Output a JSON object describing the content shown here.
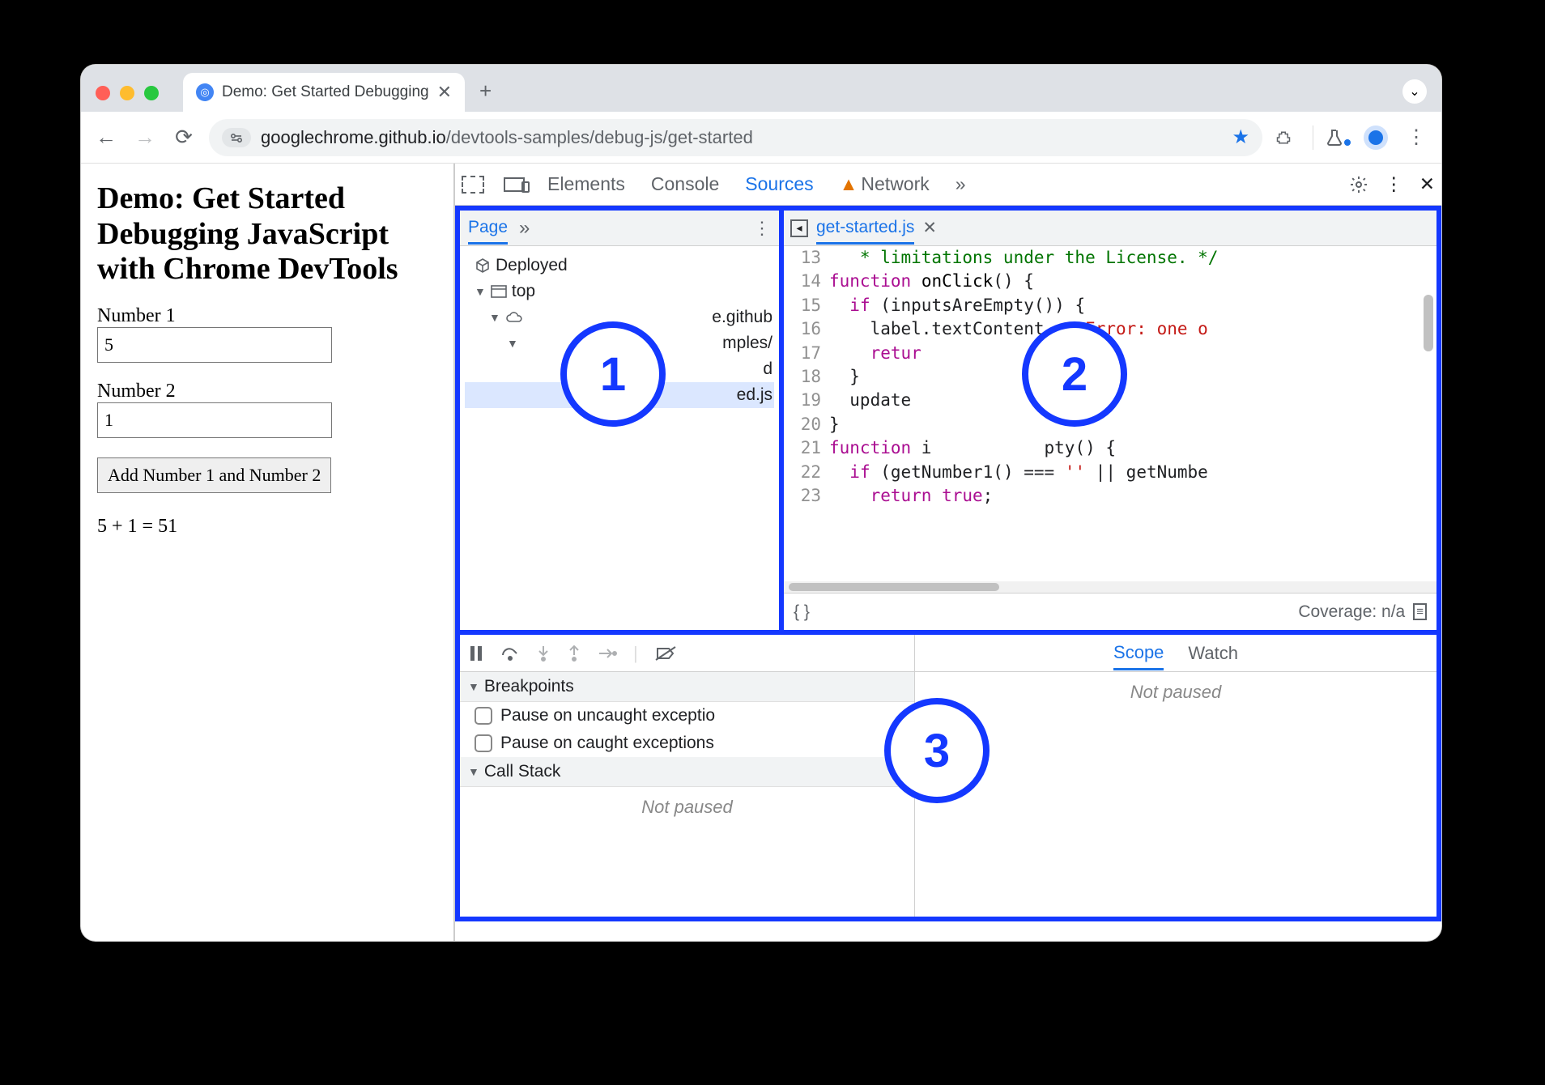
{
  "browser": {
    "tab_title": "Demo: Get Started Debugging",
    "url_host": "googlechrome.github.io",
    "url_path": "/devtools-samples/debug-js/get-started"
  },
  "page": {
    "heading": "Demo: Get Started Debugging JavaScript with Chrome DevTools",
    "label1": "Number 1",
    "value1": "5",
    "label2": "Number 2",
    "value2": "1",
    "button": "Add Number 1 and Number 2",
    "result": "5 + 1 = 51"
  },
  "devtools": {
    "tabs": {
      "elements": "Elements",
      "console": "Console",
      "sources": "Sources",
      "network": "Network"
    },
    "nav": {
      "page_tab": "Page",
      "deployed": "Deployed",
      "top": "top",
      "domain_frag": "e.github",
      "folder_frag": "mples/",
      "file_frag": "ed.js"
    },
    "editor": {
      "filename": "get-started.js",
      "coverage": "Coverage: n/a",
      "lines": [
        {
          "n": "13",
          "html": "<span class='com'>   * limitations under the License. */</span>"
        },
        {
          "n": "14",
          "html": "<span class='kw'>function</span> <span class='fn'>onClick</span>() {"
        },
        {
          "n": "15",
          "html": "  <span class='kw'>if</span> (inputsAreEmpty()) {"
        },
        {
          "n": "16",
          "html": "    label.textContent = <span class='str'>'Error: one o</span>"
        },
        {
          "n": "17",
          "html": "    <span class='kw'>retur</span>"
        },
        {
          "n": "18",
          "html": "  }"
        },
        {
          "n": "19",
          "html": "  update"
        },
        {
          "n": "20",
          "html": "}"
        },
        {
          "n": "21",
          "html": "<span class='kw'>function</span> i           pty() {"
        },
        {
          "n": "22",
          "html": "  <span class='kw'>if</span> (getNumber1() === <span class='str'>''</span> || getNumbe"
        },
        {
          "n": "23",
          "html": "    <span class='kw'>return</span> <span class='kw'>true</span>;"
        }
      ]
    },
    "debugger": {
      "breakpoints": "Breakpoints",
      "pause_uncaught": "Pause on uncaught exceptio",
      "pause_caught": "Pause on caught exceptions",
      "callstack": "Call Stack",
      "not_paused": "Not paused",
      "scope": "Scope",
      "watch": "Watch"
    }
  },
  "annotations": {
    "a1": "1",
    "a2": "2",
    "a3": "3"
  }
}
